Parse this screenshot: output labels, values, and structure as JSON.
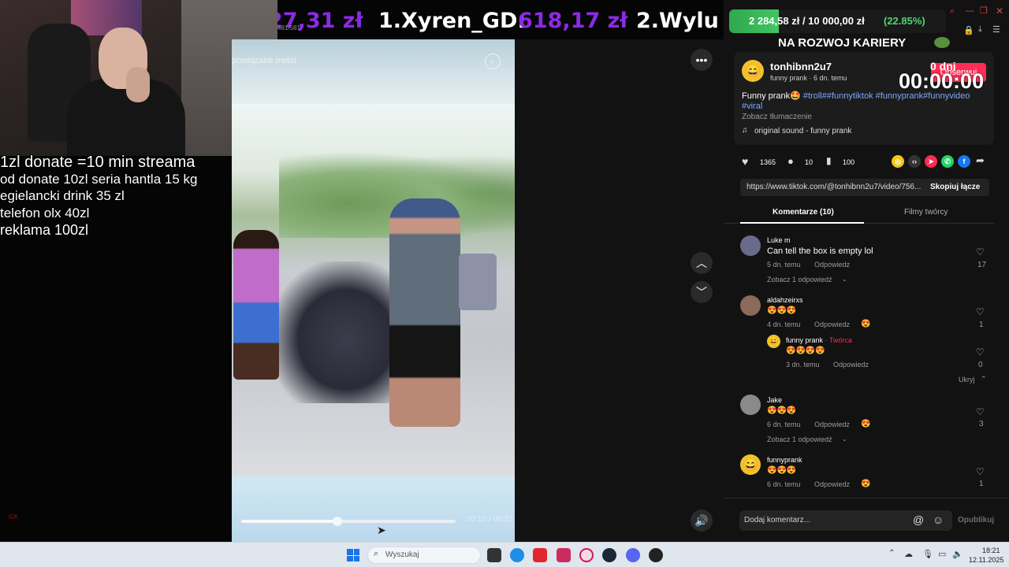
{
  "overlay": {
    "donate_lines": [
      "1zl donate =10 min streama",
      "od donate 10zl seria hantla 15 kg",
      "egielancki drink 35 zl",
      "telefon olx 40zl",
      "reklama 100zl"
    ],
    "gx_label": "GX"
  },
  "ticker": {
    "left_amount": "27,31 zł",
    "entry": "1.Xyren_GD:",
    "entry_amount": "618,17 zł",
    "next": "2.Wylu"
  },
  "goal": {
    "amount": "2 284,58 zł / 10 000,00 zł",
    "percent_text": "(22.85%)",
    "progress": 0.2285,
    "title": "NA ROZWOJ KARIERY"
  },
  "video": {
    "search_placeholder": "powiązane treści",
    "progress": 0.45,
    "time_text": "00:10 / 00:22",
    "badge_text": "481/581"
  },
  "post": {
    "username": "tonhibnn2u7",
    "subtitle": "funny prank · 6 dn. temu",
    "follow_label": "Obserwuj",
    "timer_days": "0 dni",
    "timer": "00:00:00",
    "caption": "Funny prank🤩",
    "hashtags_line1": "#troll##funnytiktok #funnyprank#funnyvideo",
    "hashtags_line2": "#viral",
    "translate": "Zobacz tłumaczenie",
    "sound": "original sound - funny prank",
    "likes": "1365",
    "comments": "10",
    "saves": "100",
    "link": "https://www.tiktok.com/@tonhibnn2u7/video/756...",
    "copy_label": "Skopiuj łącze"
  },
  "tabs": [
    "Komentarze (10)",
    "Filmy twórcy"
  ],
  "comments": [
    {
      "user": "Luke m",
      "text": "Can tell the box is empty lol",
      "time": "5 dn. temu",
      "reply": "Odpowiedz",
      "likes": "17",
      "more": "Zobacz 1 odpowiedź"
    },
    {
      "user": "aldahzeirxs",
      "text": "😍😍😍",
      "time": "4 dn. temu",
      "reply": "Odpowiedz",
      "likes": "1"
    },
    {
      "user": "funny prank",
      "creator": "· Twórca",
      "text": "😍😍😍😍",
      "time": "3 dn. temu",
      "reply": "Odpowiedz",
      "likes": "0",
      "hide": "Ukryj"
    },
    {
      "user": "Jake",
      "text": "😍😍😍",
      "time": "6 dn. temu",
      "reply": "Odpowiedz",
      "likes": "3",
      "more": "Zobacz 1 odpowiedź"
    },
    {
      "user": "funnyprank",
      "text": "😍😍😍",
      "time": "6 dn. temu",
      "reply": "Odpowiedz",
      "likes": "1"
    }
  ],
  "composer": {
    "placeholder": "Dodaj komentarz...",
    "publish": "Opublikuj"
  },
  "taskbar": {
    "search_placeholder": "Wyszukaj",
    "time": "18:21",
    "date": "12.11.2025"
  }
}
